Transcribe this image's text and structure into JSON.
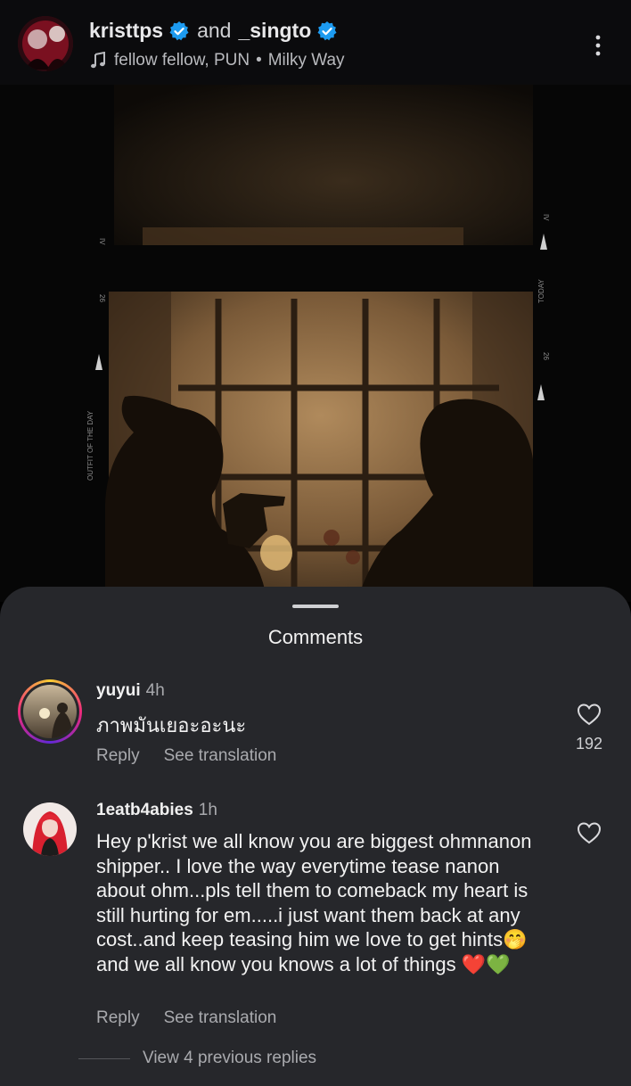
{
  "header": {
    "user1": "kristtps",
    "and": "and",
    "user2": "_singto",
    "music": "fellow fellow, PUN",
    "separator": "•",
    "song": "Milky Way"
  },
  "photo": {
    "film_text_left_top": "IV",
    "film_text_left_mid": "26",
    "film_text_left_bottom": "OUTFIT OF THE DAY",
    "film_text_right_top": "IV",
    "film_text_right_mid": "TODAY",
    "film_text_right_bottom": "26"
  },
  "comments_sheet": {
    "title": "Comments",
    "comments": [
      {
        "user": "yuyui",
        "time": "4h",
        "text": "ภาพมันเยอะอะนะ",
        "reply_label": "Reply",
        "translate_label": "See translation",
        "likes": "192"
      },
      {
        "user": "1eatb4abies",
        "time": "1h",
        "text": "Hey p'krist we all know you are biggest ohmnanon shipper.. I love the way everytime tease nanon about ohm...pls tell them to comeback my heart is still hurting for em.....i just want them back at any cost..and keep teasing him we love to get hints🤭and we all know you knows a lot of things ❤️💚",
        "reply_label": "Reply",
        "translate_label": "See translation"
      }
    ],
    "view_replies": "View 4 previous replies"
  },
  "colors": {
    "sheet_bg": "#26272b",
    "verified_blue": "#1d9bf0",
    "header_bg": "#0b0b0d"
  }
}
